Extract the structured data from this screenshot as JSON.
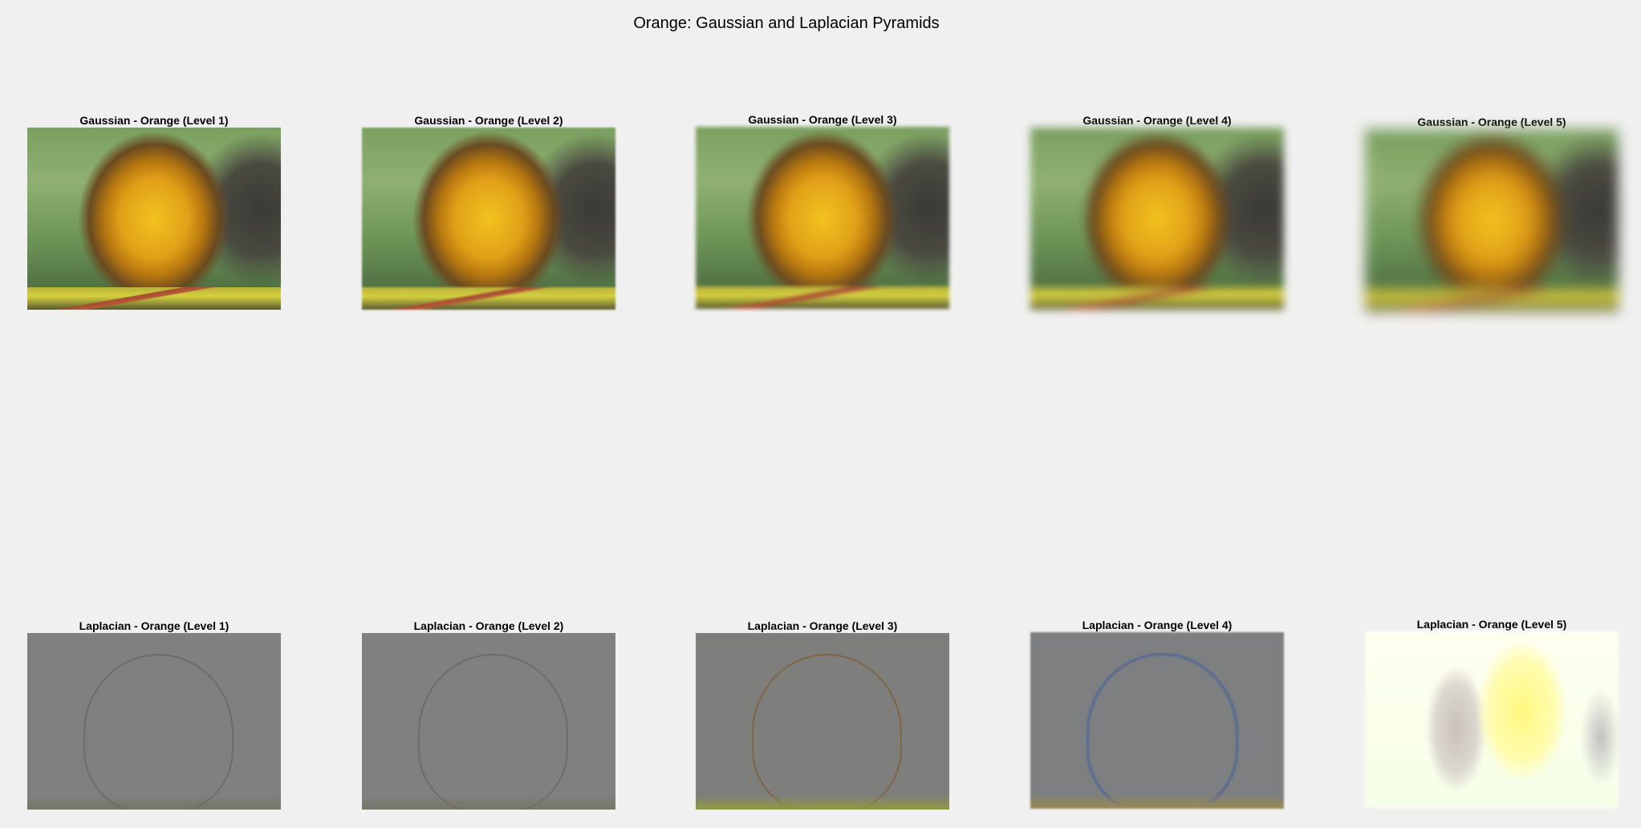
{
  "figure": {
    "title": "Orange: Gaussian and Laplacian Pyramids"
  },
  "gaussian": [
    {
      "title": "Gaussian - Orange (Level 1)"
    },
    {
      "title": "Gaussian - Orange (Level 2)"
    },
    {
      "title": "Gaussian - Orange (Level 3)"
    },
    {
      "title": "Gaussian - Orange (Level 4)"
    },
    {
      "title": "Gaussian - Orange (Level 5)"
    }
  ],
  "laplacian": [
    {
      "title": "Laplacian - Orange (Level 1)"
    },
    {
      "title": "Laplacian - Orange (Level 2)"
    },
    {
      "title": "Laplacian - Orange (Level 3)"
    },
    {
      "title": "Laplacian - Orange (Level 4)"
    },
    {
      "title": "Laplacian - Orange (Level 5)"
    }
  ]
}
